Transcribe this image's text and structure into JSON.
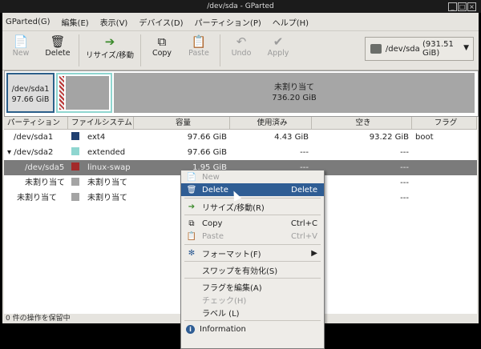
{
  "window": {
    "title": "/dev/sda - GParted"
  },
  "menubar": [
    "GParted(G)",
    "編集(E)",
    "表示(V)",
    "デバイス(D)",
    "パーティション(P)",
    "ヘルプ(H)"
  ],
  "toolbar": {
    "new": "New",
    "delete": "Delete",
    "resize": "リサイズ/移動",
    "copy": "Copy",
    "paste": "Paste",
    "undo": "Undo",
    "apply": "Apply"
  },
  "device_selector": {
    "device": "/dev/sda",
    "size": "(931.51 GiB)"
  },
  "diskmap": {
    "sda1_name": "/dev/sda1",
    "sda1_size": "97.66 GiB",
    "unalloc_label": "未割り当て",
    "unalloc_size": "736.20 GiB"
  },
  "columns": [
    "パーティション",
    "ファイルシステム",
    "容量",
    "使用済み",
    "空き",
    "フラグ"
  ],
  "rows": [
    {
      "partition": "/dev/sda1",
      "fs": "ext4",
      "fs_color": "#1f3f70",
      "size": "97.66 GiB",
      "used": "4.43 GiB",
      "free": "93.22 GiB",
      "flags": "boot"
    },
    {
      "partition": "/dev/sda2",
      "fs": "extended",
      "fs_color": "#8fd6d0",
      "size": "97.66 GiB",
      "used": "---",
      "free": "---",
      "flags": ""
    },
    {
      "partition": "/dev/sda5",
      "fs": "linux-swap",
      "fs_color": "#a32a2a",
      "size": "1.95 GiB",
      "used": "---",
      "free": "---",
      "flags": ""
    },
    {
      "partition": "未割り当て",
      "fs": "未割り当て",
      "fs_color": "#a4a4a4",
      "size": "",
      "used": "---",
      "free": "---",
      "flags": ""
    },
    {
      "partition": "未割り当て",
      "fs": "未割り当て",
      "fs_color": "#a4a4a4",
      "size": "",
      "used": "---",
      "free": "---",
      "flags": ""
    }
  ],
  "statusbar": "0 件の操作を保留中",
  "context_menu": {
    "new": "New",
    "delete": "Delete",
    "delete_acc": "Delete",
    "resize": "リサイズ/移動(R)",
    "copy": "Copy",
    "copy_acc": "Ctrl+C",
    "paste": "Paste",
    "paste_acc": "Ctrl+V",
    "format": "フォーマット(F)",
    "swapon": "スワップを有効化(S)",
    "flags": "フラグを編集(A)",
    "check": "チェック(H)",
    "label": "ラベル (L)",
    "info": "Information"
  }
}
